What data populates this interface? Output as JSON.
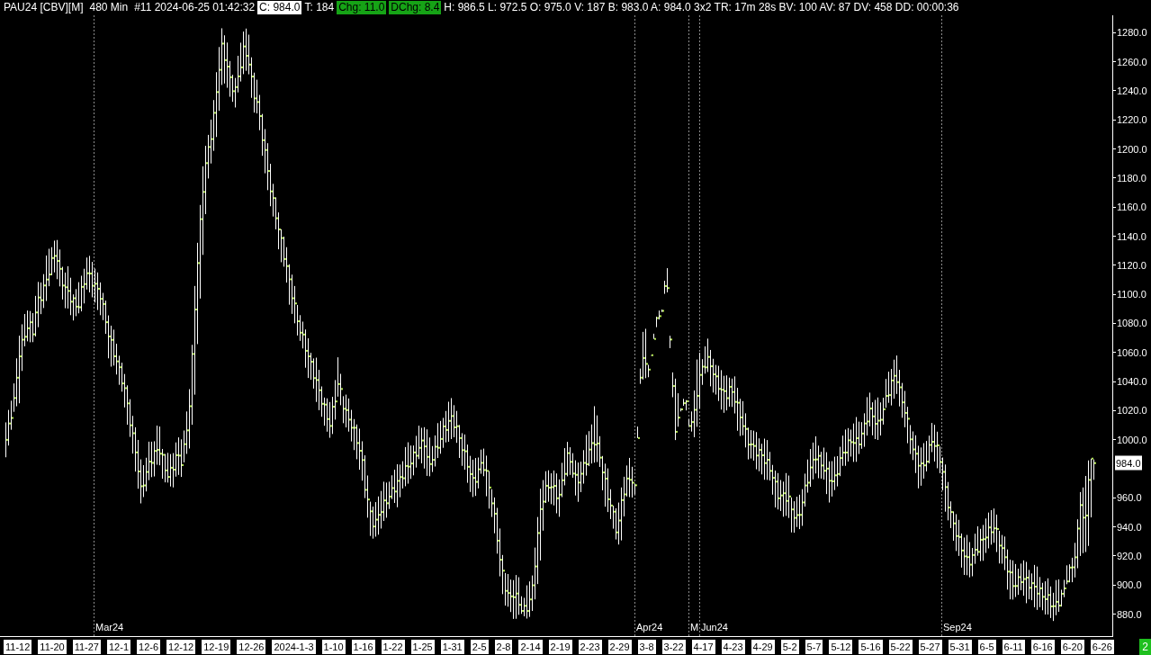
{
  "header": {
    "items": [
      {
        "text": "PAU24 [CBV][M]",
        "kind": "plain"
      },
      {
        "text": "480 Min",
        "kind": "plain"
      },
      {
        "text": "#11 2024-06-25 01:42:32",
        "kind": "plain"
      },
      {
        "text": "C: 984.0",
        "kind": "highlight"
      },
      {
        "text": "T: 184",
        "kind": "plain"
      },
      {
        "text": "Chg: 11.0",
        "kind": "positive"
      },
      {
        "text": "DChg: 8.4",
        "kind": "positive"
      },
      {
        "text": "H: 986.5 L: 972.5 O: 975.0 V: 187 B: 983.0 A: 984.0 3x2 TR: 17m 28s BV: 100 AV: 87 DV: 458 DD: 00:00:36",
        "kind": "plain"
      }
    ]
  },
  "chart": {
    "contract_markers": [
      "Mar24",
      "Apr24",
      "M",
      "Jun24",
      "Sep24"
    ],
    "price_axis": [
      {
        "text": "1280.0",
        "kind": "tick"
      },
      {
        "text": "1260.0",
        "kind": "tick"
      },
      {
        "text": "1240.0",
        "kind": "tick"
      },
      {
        "text": "1220.0",
        "kind": "tick"
      },
      {
        "text": "1200.0",
        "kind": "tick"
      },
      {
        "text": "1180.0",
        "kind": "tick"
      },
      {
        "text": "1160.0",
        "kind": "tick"
      },
      {
        "text": "1140.0",
        "kind": "tick"
      },
      {
        "text": "1120.0",
        "kind": "tick"
      },
      {
        "text": "1100.0",
        "kind": "tick"
      },
      {
        "text": "1080.0",
        "kind": "tick"
      },
      {
        "text": "1060.0",
        "kind": "tick"
      },
      {
        "text": "1040.0",
        "kind": "tick"
      },
      {
        "text": "1020.0",
        "kind": "tick"
      },
      {
        "text": "1000.0",
        "kind": "tick"
      },
      {
        "text": "984.0",
        "kind": "last_price"
      },
      {
        "text": "960.0",
        "kind": "tick"
      },
      {
        "text": "940.0",
        "kind": "tick"
      },
      {
        "text": "920.0",
        "kind": "tick"
      },
      {
        "text": "900.0",
        "kind": "tick"
      },
      {
        "text": "880.0",
        "kind": "tick"
      }
    ],
    "time_axis": [
      "11-12",
      "11-20",
      "11-27",
      "12-1",
      "12-6",
      "12-12",
      "12-19",
      "12-26",
      "2024-1-3",
      "1-10",
      "1-16",
      "1-22",
      "1-25",
      "1-31",
      "2-5",
      "2-8",
      "2-14",
      "2-19",
      "2-23",
      "2-29",
      "3-8",
      "3-22",
      "4-17",
      "4-23",
      "4-29",
      "5-2",
      "5-7",
      "5-12",
      "5-16",
      "5-22",
      "5-27",
      "5-31",
      "6-5",
      "6-11",
      "6-16",
      "6-20",
      "6-26"
    ]
  },
  "status_badge": {
    "text": "2"
  }
}
